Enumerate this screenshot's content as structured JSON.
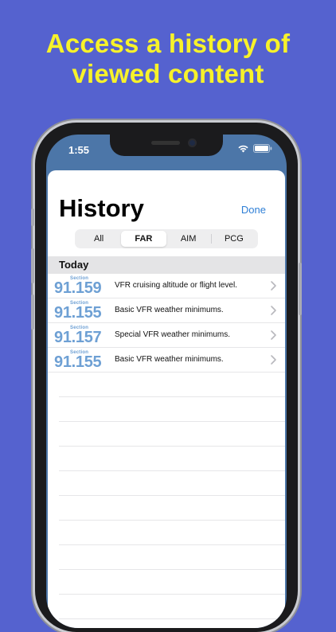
{
  "promo": {
    "title_line1": "Access a history of",
    "title_line2": "viewed content"
  },
  "status_bar": {
    "time": "1:55",
    "icons": [
      "wifi-icon",
      "battery-icon"
    ]
  },
  "history": {
    "title": "History",
    "done_label": "Done",
    "tabs": [
      {
        "label": "All",
        "selected": false
      },
      {
        "label": "FAR",
        "selected": true
      },
      {
        "label": "AIM",
        "selected": false
      },
      {
        "label": "PCG",
        "selected": false
      }
    ],
    "section_title": "Today",
    "items": [
      {
        "section_label": "Section",
        "number": "91.159",
        "text": "VFR cruising altitude or flight level."
      },
      {
        "section_label": "Section",
        "number": "91.155",
        "text": "Basic VFR weather minimums."
      },
      {
        "section_label": "Section",
        "number": "91.157",
        "text": "Special VFR weather minimums."
      },
      {
        "section_label": "Section",
        "number": "91.155",
        "text": "Basic VFR weather minimums."
      }
    ]
  },
  "colors": {
    "background": "#5562cf",
    "promo_text": "#f7f22a",
    "accent": "#2f7fd6",
    "section_number": "#6ea0d4"
  }
}
